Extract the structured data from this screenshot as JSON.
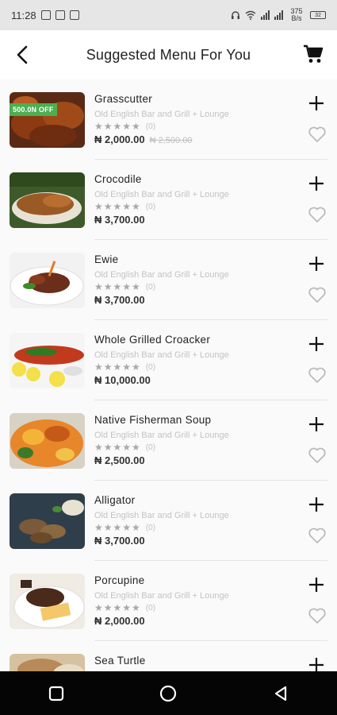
{
  "status_bar": {
    "time": "11:28",
    "net_speed": "375 B/s",
    "battery": "32"
  },
  "header": {
    "title": "Suggested Menu For You",
    "back_icon": "back-arrow-icon",
    "cart_icon": "shopping-cart-icon"
  },
  "items": [
    {
      "name": "Grasscutter",
      "restaurant": "Old English Bar and Grill + Lounge",
      "rating": "(0)",
      "price": "₦ 2,000.00",
      "old_price": "₦ 2,500.00",
      "badge": "500.0N OFF"
    },
    {
      "name": "Crocodile",
      "restaurant": "Old English Bar and Grill + Lounge",
      "rating": "(0)",
      "price": "₦ 3,700.00"
    },
    {
      "name": "Ewie",
      "restaurant": "Old English Bar and Grill + Lounge",
      "rating": "(0)",
      "price": "₦ 3,700.00"
    },
    {
      "name": "Whole Grilled Croacker",
      "restaurant": "Old English Bar and Grill + Lounge",
      "rating": "(0)",
      "price": "₦ 10,000.00"
    },
    {
      "name": "Native Fisherman Soup",
      "restaurant": "Old English Bar and Grill + Lounge",
      "rating": "(0)",
      "price": "₦ 2,500.00"
    },
    {
      "name": "Alligator",
      "restaurant": "Old English Bar and Grill + Lounge",
      "rating": "(0)",
      "price": "₦ 3,700.00"
    },
    {
      "name": "Porcupine",
      "restaurant": "Old English Bar and Grill + Lounge",
      "rating": "(0)",
      "price": "₦ 2,000.00"
    },
    {
      "name": "Sea Turtle"
    }
  ],
  "colors": {
    "badge_green": "#4caf50",
    "muted_text": "#c3c3c3",
    "nav_bar": "#050505"
  }
}
